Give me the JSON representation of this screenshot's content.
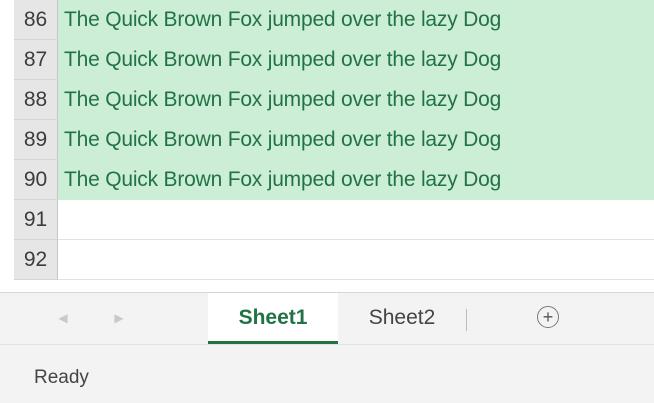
{
  "grid": {
    "rows": [
      {
        "number": "86",
        "text": "The Quick Brown Fox jumped over the lazy Dog",
        "selected": true
      },
      {
        "number": "87",
        "text": "The Quick Brown Fox jumped over the lazy Dog",
        "selected": true
      },
      {
        "number": "88",
        "text": "The Quick Brown Fox jumped over the lazy Dog",
        "selected": true
      },
      {
        "number": "89",
        "text": "The Quick Brown Fox jumped over the lazy Dog",
        "selected": true
      },
      {
        "number": "90",
        "text": "The Quick Brown Fox jumped over the lazy Dog",
        "selected": true
      },
      {
        "number": "91",
        "text": "",
        "selected": false
      },
      {
        "number": "92",
        "text": "",
        "selected": false
      }
    ],
    "selection_color": "#cdeed6",
    "text_color": "#217346"
  },
  "sheet_tabs": {
    "tabs": [
      {
        "label": "Sheet1",
        "active": true
      },
      {
        "label": "Sheet2",
        "active": false
      }
    ],
    "prev_icon": "chevron-left-icon",
    "next_icon": "chevron-right-icon",
    "add_icon": "plus-circle-icon",
    "accent_color": "#217346"
  },
  "status_bar": {
    "status": "Ready"
  }
}
